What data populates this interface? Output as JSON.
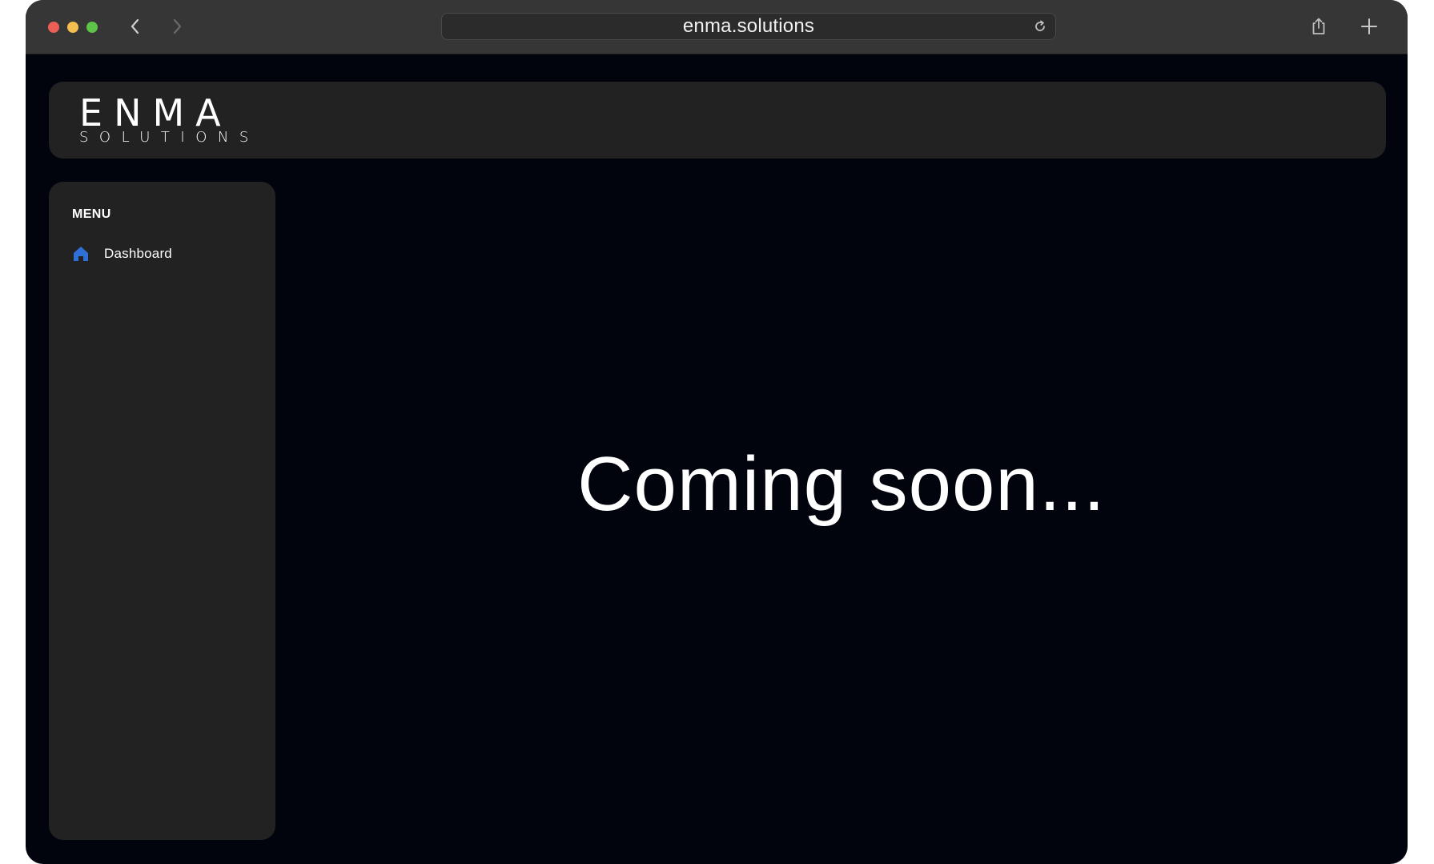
{
  "browser": {
    "url": "enma.solutions",
    "icons": {
      "close": "close-dot",
      "minimize": "minimize-dot",
      "zoom": "zoom-dot",
      "back": "chevron-left-icon",
      "forward": "chevron-right-icon",
      "reload": "reload-icon",
      "share": "share-icon",
      "new_tab": "plus-icon"
    },
    "traffic_colors": {
      "close": "#ec5f56",
      "minimize": "#f4bd4f",
      "zoom": "#5ec449"
    }
  },
  "header": {
    "logo_main": "ENMA",
    "logo_sub": "SOLUTIONS"
  },
  "sidebar": {
    "heading": "MENU",
    "items": [
      {
        "label": "Dashboard",
        "icon": "home-icon",
        "icon_color": "#2f6fd6"
      }
    ]
  },
  "main": {
    "message": "Coming soon..."
  },
  "colors": {
    "page_bg": "#02040d",
    "panel_bg": "#222222",
    "titlebar_bg": "#363636",
    "accent": "#2f6fd6"
  }
}
